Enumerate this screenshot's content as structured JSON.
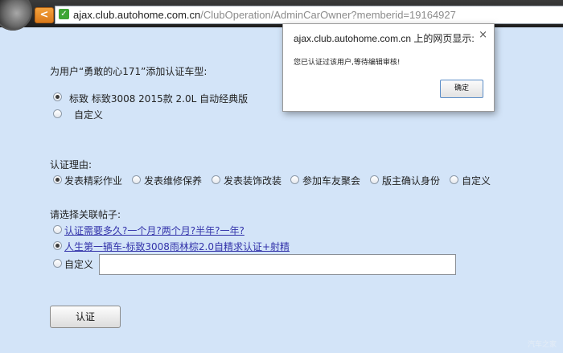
{
  "browser": {
    "url_host": "ajax.club.autohome.com.cn",
    "url_path": "/ClubOperation/AdminCarOwner?memberid=19164927"
  },
  "form": {
    "heading": "为用户“勇敢的心171”添加认证车型:",
    "car_options": [
      {
        "label": "标致 标致3008 2015款 2.0L 自动经典版",
        "selected": true
      },
      {
        "label": "自定义",
        "selected": false
      }
    ],
    "reason_heading": "认证理由:",
    "reasons": [
      {
        "label": "发表精彩作业",
        "selected": true
      },
      {
        "label": "发表维修保养",
        "selected": false
      },
      {
        "label": "发表装饰改装",
        "selected": false
      },
      {
        "label": "参加车友聚会",
        "selected": false
      },
      {
        "label": "版主确认身份",
        "selected": false
      },
      {
        "label": "自定义",
        "selected": false
      }
    ],
    "post_heading": "请选择关联帖子:",
    "posts": [
      {
        "label": "认证需要多久?一个月?两个月?半年?一年?",
        "selected": false
      },
      {
        "label": "人生第一辆车-标致3008雨林棕2.0自精求认证+射精",
        "selected": true
      },
      {
        "label": "自定义",
        "selected": false
      }
    ],
    "custom_input_value": "",
    "submit_label": "认证"
  },
  "dialog": {
    "title": "ajax.club.autohome.com.cn 上的网页显示:",
    "close_glyph": "×",
    "message": "您已认证过该用户,等待编辑审核!",
    "ok_label": "确定"
  },
  "watermark": "汽车之家"
}
